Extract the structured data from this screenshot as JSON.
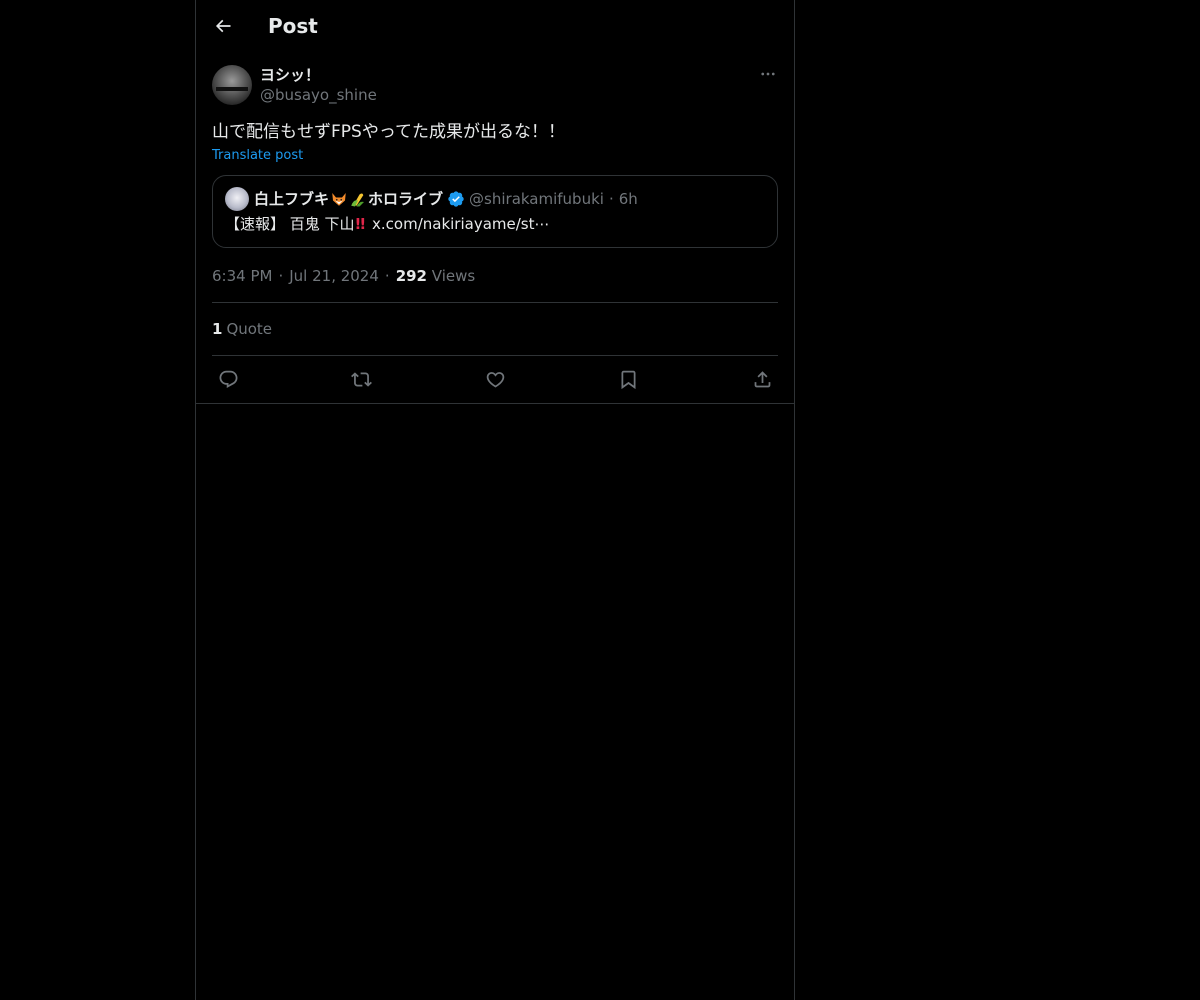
{
  "header": {
    "title": "Post",
    "back_icon": "arrow-left-icon"
  },
  "post": {
    "display_name": "ヨシッ！",
    "handle": "@busayo_shine",
    "text": "山で配信もせずFPSやってた成果が出るな！！",
    "translate_label": "Translate post",
    "time": "6:34 PM",
    "date": "Jul 21, 2024",
    "views_count": "292",
    "views_label": "Views",
    "separator": "·",
    "quote_count": "1",
    "quote_label": "Quote"
  },
  "quoted_post": {
    "name_part1": "白上フブキ",
    "name_part2": "ホロライブ",
    "handle": "@shirakamifubuki",
    "separator": "·",
    "time": "6h",
    "body_prefix": "【速報】 百鬼 下山",
    "bangs": "!!",
    "link": "x.com/nakiriayame/st⋯"
  },
  "colors": {
    "background": "#000000",
    "border": "#2f3336",
    "text_primary": "#e7e9ea",
    "text_secondary": "#71767b",
    "accent": "#1d9bf0"
  },
  "actions": [
    "reply-icon",
    "repost-icon",
    "like-icon",
    "bookmark-icon",
    "share-icon"
  ]
}
